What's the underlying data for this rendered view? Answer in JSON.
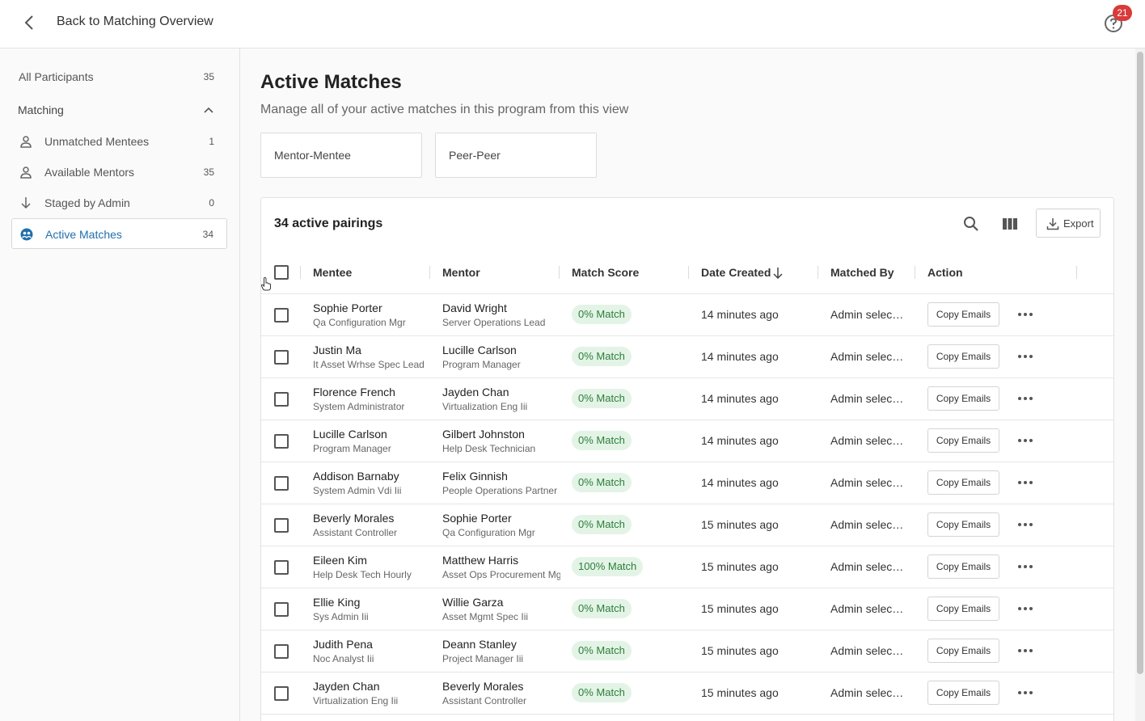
{
  "header": {
    "back_label": "Back to Matching Overview",
    "notifications_count": "21"
  },
  "sidebar": {
    "all_participants": {
      "label": "All Participants",
      "count": "35"
    },
    "section_label": "Matching",
    "items": [
      {
        "label": "Unmatched Mentees",
        "count": "1",
        "icon": "person-icon"
      },
      {
        "label": "Available Mentors",
        "count": "35",
        "icon": "person-icon"
      },
      {
        "label": "Staged by Admin",
        "count": "0",
        "icon": "arrow-down-icon"
      },
      {
        "label": "Active Matches",
        "count": "34",
        "icon": "match-icon"
      }
    ]
  },
  "main": {
    "title": "Active Matches",
    "subtitle": "Manage all of your active matches in this program from this view",
    "types": [
      "Mentor-Mentee",
      "Peer-Peer"
    ],
    "table_title": "34 active pairings",
    "export_label": "Export",
    "columns": [
      "Mentee",
      "Mentor",
      "Match Score",
      "Date Created",
      "Matched By",
      "Action"
    ],
    "copy_label": "Copy Emails",
    "rows": [
      {
        "mentee": "Sophie Porter",
        "mentee_role": "Qa Configuration Mgr",
        "mentor": "David Wright",
        "mentor_role": "Server Operations Lead",
        "score": "0% Match",
        "date": "14 minutes ago",
        "by": "Admin selected"
      },
      {
        "mentee": "Justin Ma",
        "mentee_role": "It Asset Wrhse Spec Lead",
        "mentor": "Lucille Carlson",
        "mentor_role": "Program Manager",
        "score": "0% Match",
        "date": "14 minutes ago",
        "by": "Admin selected"
      },
      {
        "mentee": "Florence French",
        "mentee_role": "System Administrator",
        "mentor": "Jayden Chan",
        "mentor_role": "Virtualization Eng Iii",
        "score": "0% Match",
        "date": "14 minutes ago",
        "by": "Admin selected"
      },
      {
        "mentee": "Lucille Carlson",
        "mentee_role": "Program Manager",
        "mentor": "Gilbert Johnston",
        "mentor_role": "Help Desk Technician",
        "score": "0% Match",
        "date": "14 minutes ago",
        "by": "Admin selected"
      },
      {
        "mentee": "Addison Barnaby",
        "mentee_role": "System Admin Vdi Iii",
        "mentor": "Felix Ginnish",
        "mentor_role": "People Operations Partner",
        "score": "0% Match",
        "date": "14 minutes ago",
        "by": "Admin selected"
      },
      {
        "mentee": "Beverly Morales",
        "mentee_role": "Assistant Controller",
        "mentor": "Sophie Porter",
        "mentor_role": "Qa Configuration Mgr",
        "score": "0% Match",
        "date": "15 minutes ago",
        "by": "Admin selected"
      },
      {
        "mentee": "Eileen Kim",
        "mentee_role": "Help Desk Tech Hourly",
        "mentor": "Matthew Harris",
        "mentor_role": "Asset Ops Procurement Mgr",
        "score": "100% Match",
        "date": "15 minutes ago",
        "by": "Admin selected"
      },
      {
        "mentee": "Ellie King",
        "mentee_role": "Sys Admin Iii",
        "mentor": "Willie Garza",
        "mentor_role": "Asset Mgmt Spec Iii",
        "score": "0% Match",
        "date": "15 minutes ago",
        "by": "Admin selected"
      },
      {
        "mentee": "Judith Pena",
        "mentee_role": "Noc Analyst Iii",
        "mentor": "Deann Stanley",
        "mentor_role": "Project Manager Iii",
        "score": "0% Match",
        "date": "15 minutes ago",
        "by": "Admin selected"
      },
      {
        "mentee": "Jayden Chan",
        "mentee_role": "Virtualization Eng Iii",
        "mentor": "Beverly Morales",
        "mentor_role": "Assistant Controller",
        "score": "0% Match",
        "date": "15 minutes ago",
        "by": "Admin selected"
      }
    ]
  },
  "colors": {
    "accent": "#1f6fae",
    "badge": "#d93a3a",
    "score_bg": "#e3f4e6",
    "score_text": "#2e7d3b"
  }
}
